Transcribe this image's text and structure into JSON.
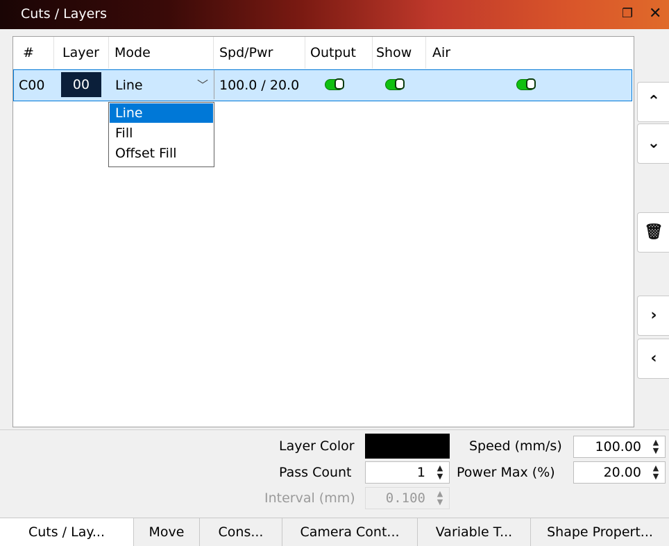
{
  "window": {
    "title": "Cuts / Layers",
    "restore_icon": "restore-icon",
    "close_icon": "close-icon"
  },
  "columns": [
    "#",
    "Layer",
    "Mode",
    "Spd/Pwr",
    "Output",
    "Show",
    "Air"
  ],
  "row": {
    "id": "C00",
    "layer": "00",
    "layer_color": "#000000",
    "mode": "Line",
    "spd_pwr": "100.0 / 20.0",
    "output": true,
    "show": true,
    "air": true
  },
  "mode_options": [
    "Line",
    "Fill",
    "Offset Fill"
  ],
  "mode_selected_index": 0,
  "side_buttons": [
    "chevron-up-icon",
    "chevron-down-icon",
    "trash-icon",
    "chevron-right-icon",
    "chevron-left-icon"
  ],
  "props": {
    "layer_color_label": "Layer Color",
    "layer_color": "#000000",
    "pass_count_label": "Pass Count",
    "pass_count": "1",
    "interval_label": "Interval (mm)",
    "interval": "0.100",
    "speed_label": "Speed (mm/s)",
    "speed": "100.00",
    "power_label": "Power Max (%)",
    "power": "20.00"
  },
  "tabs": [
    "Cuts / Lay...",
    "Move",
    "Cons...",
    "Camera Cont...",
    "Variable T...",
    "Shape Propert..."
  ],
  "active_tab": 0
}
